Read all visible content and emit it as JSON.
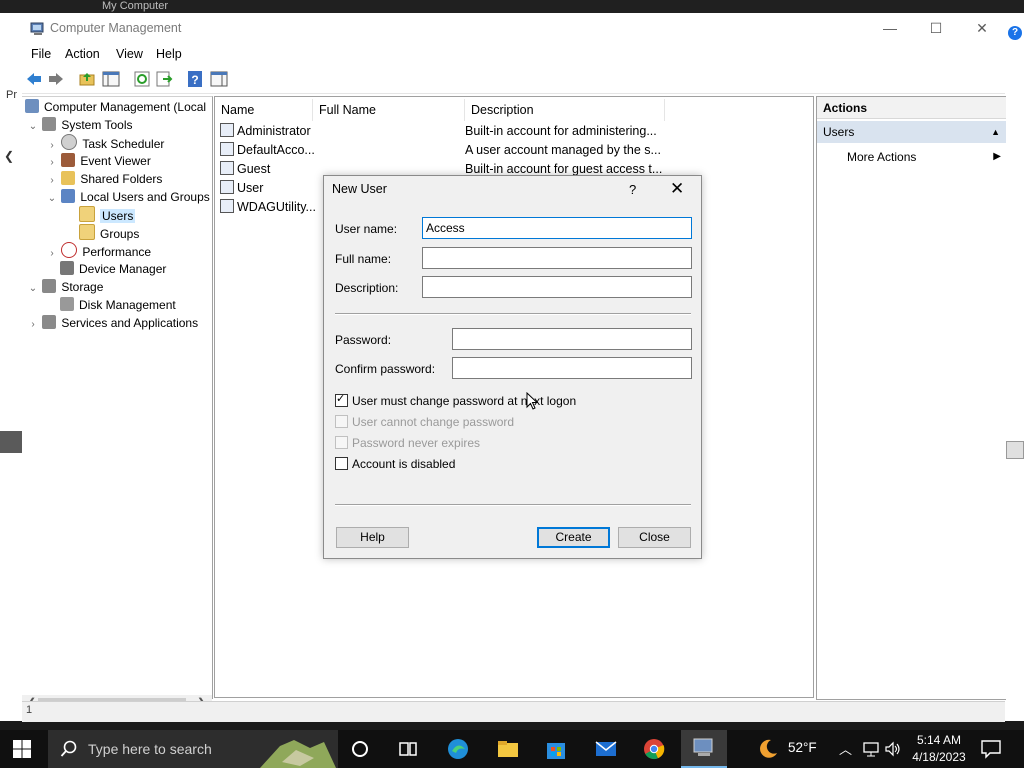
{
  "background": {
    "title_text": "My Computer",
    "left_label": "Pr"
  },
  "window": {
    "title": "Computer Management",
    "controls": {
      "minimize": "—",
      "maximize": "☐",
      "close": "✕"
    }
  },
  "menu": [
    "File",
    "Action",
    "View",
    "Help"
  ],
  "toolbar_icons": [
    "back-arrow-icon",
    "forward-arrow-icon",
    "up-folder-icon",
    "show-hide-tree-icon",
    "refresh-icon",
    "export-list-icon",
    "help-icon",
    "show-hide-action-pane-icon"
  ],
  "tree": {
    "root": "Computer Management (Local",
    "system_tools": "System Tools",
    "task_scheduler": "Task Scheduler",
    "event_viewer": "Event Viewer",
    "shared_folders": "Shared Folders",
    "local_users_groups": "Local Users and Groups",
    "users": "Users",
    "groups": "Groups",
    "performance": "Performance",
    "device_manager": "Device Manager",
    "storage": "Storage",
    "disk_management": "Disk Management",
    "services_apps": "Services and Applications"
  },
  "list": {
    "columns": [
      "Name",
      "Full Name",
      "Description"
    ],
    "rows": [
      {
        "name": "Administrator",
        "description": "Built-in account for administering..."
      },
      {
        "name": "DefaultAcco...",
        "description": "A user account managed by the s..."
      },
      {
        "name": "Guest",
        "description": "Built-in account for guest access t..."
      },
      {
        "name": "User",
        "description": ""
      },
      {
        "name": "WDAGUtility...",
        "description": ""
      }
    ]
  },
  "actions": {
    "header": "Actions",
    "section": "Users",
    "more": "More Actions"
  },
  "status": {
    "text": "1"
  },
  "dialog": {
    "title": "New User",
    "help_glyph": "?",
    "close_glyph": "✕",
    "labels": {
      "user_name": "User name:",
      "full_name": "Full name:",
      "description": "Description:",
      "password": "Password:",
      "confirm_password": "Confirm password:"
    },
    "values": {
      "user_name": "Access",
      "full_name": "",
      "description": "",
      "password": "",
      "confirm_password": ""
    },
    "checkboxes": {
      "must_change": {
        "label": "User must change password at next logon",
        "checked": true,
        "enabled": true
      },
      "cannot_change": {
        "label": "User cannot change password",
        "checked": false,
        "enabled": false
      },
      "never_expires": {
        "label": "Password never expires",
        "checked": false,
        "enabled": false
      },
      "disabled": {
        "label": "Account is disabled",
        "checked": false,
        "enabled": true
      }
    },
    "buttons": {
      "help": "Help",
      "create": "Create",
      "close": "Close"
    }
  },
  "taskbar": {
    "search_placeholder": "Type here to search",
    "temperature": "52°F",
    "time": "5:14 AM",
    "date": "4/18/2023",
    "colors": {
      "taskbar": "#101010",
      "accent": "#0078d7"
    }
  }
}
